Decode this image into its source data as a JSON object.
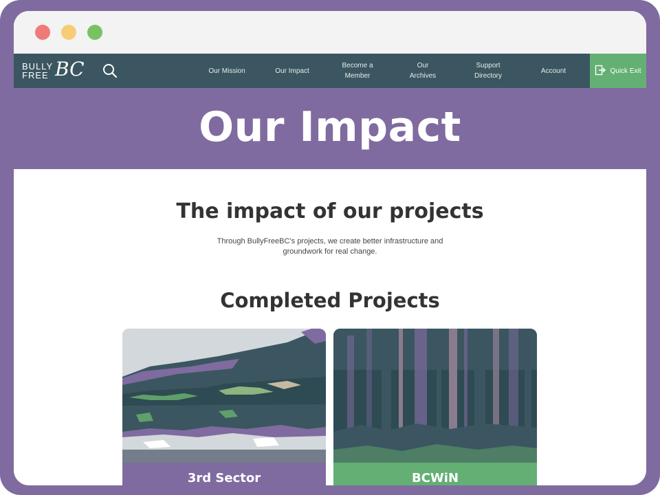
{
  "brand": {
    "logo_line1": "BULLY",
    "logo_line2": "FREE",
    "logo_script": "BC"
  },
  "nav": {
    "items": [
      {
        "label": "Our Mission"
      },
      {
        "label": "Our Impact"
      },
      {
        "label": "Become a\nMember"
      },
      {
        "label": "Our\nArchives"
      },
      {
        "label": "Support\nDirectory"
      },
      {
        "label": "Account"
      }
    ],
    "quick_exit_label": "Quick Exit"
  },
  "hero": {
    "title": "Our Impact"
  },
  "impact": {
    "heading": "The impact of our projects",
    "body_line1": "Through BullyFreeBC’s projects, we create better infrastructure and",
    "body_line2": "groundwork for real change."
  },
  "completed": {
    "heading": "Completed Projects",
    "cards": [
      {
        "label": "3rd Sector",
        "color": "#7f6b9f"
      },
      {
        "label": "BCWiN",
        "color": "#63af74"
      }
    ]
  },
  "colors": {
    "frame": "#7f6b9f",
    "nav": "#3b5660",
    "quick_exit": "#63af74"
  }
}
